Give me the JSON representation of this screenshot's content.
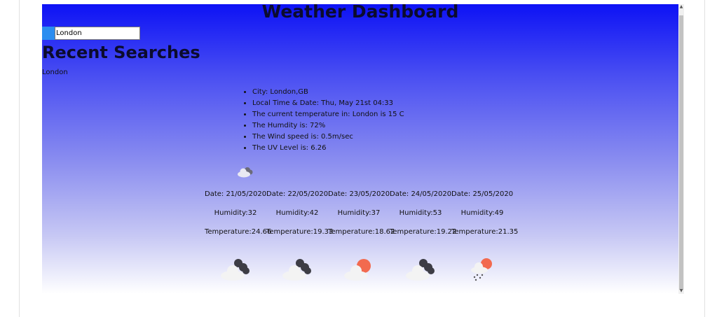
{
  "app": {
    "title": "Weather Dashboard"
  },
  "search": {
    "value": "London",
    "placeholder": ""
  },
  "recent": {
    "heading": "Recent Searches",
    "items": [
      "London"
    ]
  },
  "current": {
    "lines": [
      "City: London,GB",
      "Local Time & Date: Thu, May 21st 04:33",
      "The current temperature in: London is 15 C",
      "The Humdity is: 72%",
      "The Wind speed is: 0.5m/sec",
      "The UV Level is: 6.26"
    ],
    "icon": "cloudy-icon"
  },
  "forecast": [
    {
      "date": "Date: 21/05/2020",
      "humidity": "Humidity:32",
      "temperature": "Temperature:24.66",
      "icon": "broken-clouds-icon"
    },
    {
      "date": "Date: 22/05/2020",
      "humidity": "Humidity:42",
      "temperature": "Temperature:19.33",
      "icon": "broken-clouds-icon"
    },
    {
      "date": "Date: 23/05/2020",
      "humidity": "Humidity:37",
      "temperature": "Temperature:18.62",
      "icon": "partly-cloudy-icon"
    },
    {
      "date": "Date: 24/05/2020",
      "humidity": "Humidity:53",
      "temperature": "Temperature:19.22",
      "icon": "broken-clouds-icon"
    },
    {
      "date": "Date: 25/05/2020",
      "humidity": "Humidity:49",
      "temperature": "Temperature:21.35",
      "icon": "rain-icon"
    }
  ],
  "colors": {
    "accent_button": "#2a8df0",
    "gradient_top": "#0d12f5",
    "gradient_bottom": "#ffffff",
    "sun": "#f26a4f"
  }
}
